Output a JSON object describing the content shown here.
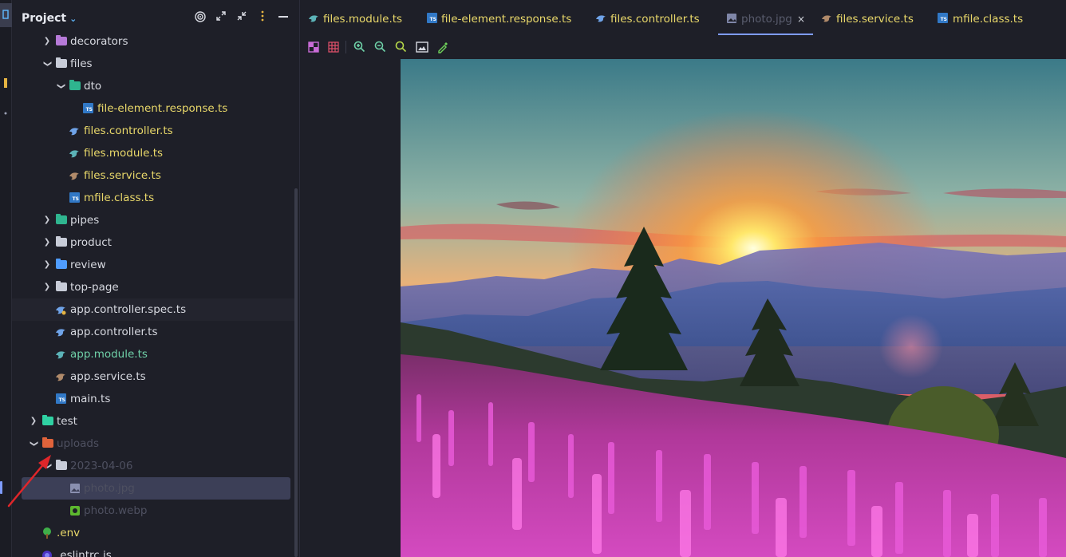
{
  "project": {
    "title": "Project",
    "header_icons": [
      "target-icon",
      "expand-icon",
      "collapse-icon",
      "more-icon",
      "minimize-icon"
    ],
    "tree": [
      {
        "label": "decorators",
        "type": "folder",
        "expanded": false
      },
      {
        "label": "files",
        "type": "folder",
        "expanded": true
      },
      {
        "label": "dto",
        "type": "folder",
        "expanded": true
      },
      {
        "label": "file-element.response.ts",
        "type": "ts"
      },
      {
        "label": "files.controller.ts",
        "type": "nest"
      },
      {
        "label": "files.module.ts",
        "type": "nest"
      },
      {
        "label": "files.service.ts",
        "type": "nest"
      },
      {
        "label": "mfile.class.ts",
        "type": "ts"
      },
      {
        "label": "pipes",
        "type": "folder",
        "expanded": false
      },
      {
        "label": "product",
        "type": "folder",
        "expanded": false
      },
      {
        "label": "review",
        "type": "folder",
        "expanded": false
      },
      {
        "label": "top-page",
        "type": "folder",
        "expanded": false
      },
      {
        "label": "app.controller.spec.ts",
        "type": "nest"
      },
      {
        "label": "app.controller.ts",
        "type": "nest"
      },
      {
        "label": "app.module.ts",
        "type": "nest"
      },
      {
        "label": "app.service.ts",
        "type": "nest"
      },
      {
        "label": "main.ts",
        "type": "ts"
      },
      {
        "label": "test",
        "type": "folder",
        "expanded": false
      },
      {
        "label": "uploads",
        "type": "folder",
        "expanded": true
      },
      {
        "label": "2023-04-06",
        "type": "folder",
        "expanded": true
      },
      {
        "label": "photo.jpg",
        "type": "image",
        "selected": true
      },
      {
        "label": "photo.webp",
        "type": "image"
      },
      {
        "label": ".env",
        "type": "env"
      },
      {
        "label": ".eslintrc.js",
        "type": "eslint"
      }
    ]
  },
  "tabs": [
    {
      "label": "files.module.ts"
    },
    {
      "label": "file-element.response.ts"
    },
    {
      "label": "files.controller.ts"
    },
    {
      "label": "photo.jpg",
      "active": true,
      "close": "×"
    },
    {
      "label": "files.service.ts"
    },
    {
      "label": "mfile.class.ts"
    }
  ],
  "toolbar_icons": [
    "background-icon",
    "grid-icon",
    "zoom-in-icon",
    "zoom-out-icon",
    "actual-size-icon",
    "fit-icon",
    "color-picker-icon"
  ],
  "colors": {
    "yellow_text": "#e9d86a",
    "green_text": "#6fd1a8",
    "default_text": "#d7d9e0",
    "ignored_text": "#4e5060",
    "accent": "#7f9cff",
    "arrow": "#e0262a"
  }
}
